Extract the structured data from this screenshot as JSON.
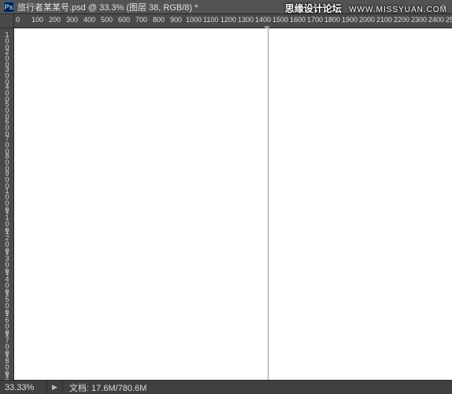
{
  "titlebar": {
    "app_icon_text": "Ps",
    "title": "旅行者某某号.psd @ 33.3% (图层 38, RGB/8) *",
    "close_label": "×"
  },
  "ruler": {
    "h_ticks": [
      {
        "pos": 2,
        "label": "0"
      },
      {
        "pos": 22,
        "label": "100"
      },
      {
        "pos": 44,
        "label": "200"
      },
      {
        "pos": 66,
        "label": "300"
      },
      {
        "pos": 88,
        "label": "400"
      },
      {
        "pos": 110,
        "label": "500"
      },
      {
        "pos": 132,
        "label": "600"
      },
      {
        "pos": 154,
        "label": "700"
      },
      {
        "pos": 176,
        "label": "800"
      },
      {
        "pos": 198,
        "label": "900"
      },
      {
        "pos": 218,
        "label": "1000"
      },
      {
        "pos": 240,
        "label": "1100"
      },
      {
        "pos": 262,
        "label": "1200"
      },
      {
        "pos": 284,
        "label": "1300"
      },
      {
        "pos": 306,
        "label": "1400"
      },
      {
        "pos": 328,
        "label": "1500"
      },
      {
        "pos": 350,
        "label": "1600"
      },
      {
        "pos": 372,
        "label": "1700"
      },
      {
        "pos": 394,
        "label": "1800"
      },
      {
        "pos": 416,
        "label": "1900"
      },
      {
        "pos": 438,
        "label": "2000"
      },
      {
        "pos": 460,
        "label": "2100"
      },
      {
        "pos": 482,
        "label": "2200"
      },
      {
        "pos": 504,
        "label": "2300"
      },
      {
        "pos": 526,
        "label": "2400"
      },
      {
        "pos": 548,
        "label": "2500"
      }
    ],
    "v_ticks": [
      {
        "pos": 4,
        "label": "100"
      },
      {
        "pos": 26,
        "label": "200"
      },
      {
        "pos": 48,
        "label": "300"
      },
      {
        "pos": 70,
        "label": "400"
      },
      {
        "pos": 92,
        "label": "500"
      },
      {
        "pos": 114,
        "label": "600"
      },
      {
        "pos": 136,
        "label": "700"
      },
      {
        "pos": 158,
        "label": "800"
      },
      {
        "pos": 180,
        "label": "900"
      },
      {
        "pos": 202,
        "label": "1000"
      },
      {
        "pos": 228,
        "label": "1100"
      },
      {
        "pos": 254,
        "label": "1200"
      },
      {
        "pos": 280,
        "label": "1300"
      },
      {
        "pos": 306,
        "label": "1400"
      },
      {
        "pos": 332,
        "label": "1500"
      },
      {
        "pos": 358,
        "label": "1600"
      },
      {
        "pos": 384,
        "label": "1700"
      },
      {
        "pos": 410,
        "label": "1800"
      },
      {
        "pos": 436,
        "label": "1900"
      }
    ]
  },
  "statusbar": {
    "zoom": "33.33%",
    "tri": "▶",
    "doc_label": "文档:",
    "doc_value": "17.6M/780.6M"
  },
  "watermark": {
    "text": "思缘设计论坛",
    "url": "WWW.MISSYUAN.COM"
  }
}
